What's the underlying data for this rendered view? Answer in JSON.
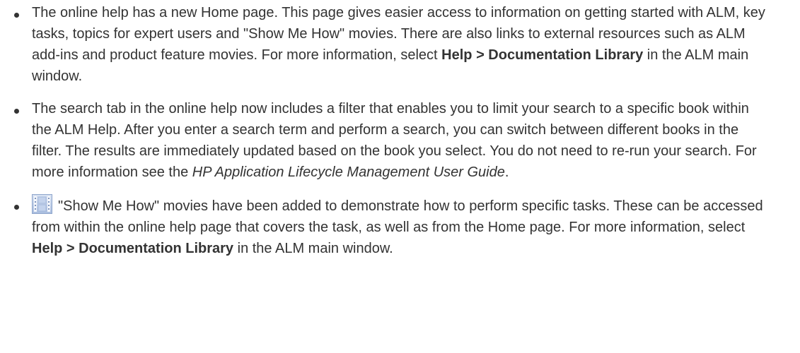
{
  "items": [
    {
      "parts": [
        "The online help has a new Home page. This page gives easier access to information on getting started with ALM, key tasks, topics for expert users and \"Show Me How\" movies. There are also links to external resources such as ALM add-ins and product feature movies. For more information, select ",
        "Help > Documentation Library",
        " in the ALM main window."
      ]
    },
    {
      "parts": [
        "The search tab in the online help now includes a filter that enables you to limit your search to a specific book within the ALM Help. After you enter a search term and perform a search, you can switch between different books in the filter. The results are immediately updated based on the book you select. You do not need to re-run your search. For more information see the ",
        "HP Application Lifecycle Management User Guide",
        "."
      ]
    },
    {
      "icon": "movie-icon",
      "parts": [
        "\"Show Me How\" movies have been added to demonstrate how to perform specific tasks. These can be accessed from within the online help page that covers the task, as well as from the Home page. For more information, select ",
        "Help > Documentation Library",
        " in the ALM main window."
      ]
    }
  ]
}
